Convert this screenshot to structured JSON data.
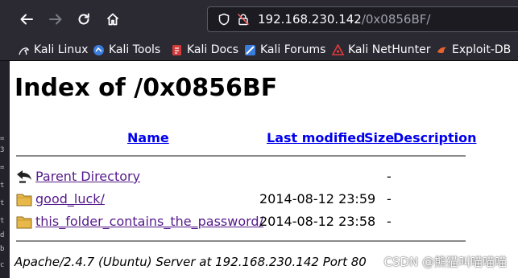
{
  "browser": {
    "url_host": "192.168.230.142",
    "url_path": "/0x0856BF/",
    "bookmarks": [
      {
        "label": "Kali Linux",
        "icon": "kali-dragon-icon"
      },
      {
        "label": "Kali Tools",
        "icon": "kali-tools-icon"
      },
      {
        "label": "Kali Docs",
        "icon": "kali-docs-icon"
      },
      {
        "label": "Kali Forums",
        "icon": "kali-forums-icon"
      },
      {
        "label": "Kali NetHunter",
        "icon": "nethunter-icon"
      },
      {
        "label": "Exploit-DB",
        "icon": "exploit-db-icon"
      }
    ]
  },
  "page": {
    "title": "Index of /0x0856BF",
    "columns": {
      "name": "Name",
      "modified": "Last modified",
      "size": "Size",
      "description": "Description"
    },
    "rows": [
      {
        "name": "Parent Directory",
        "modified": "",
        "size": "-",
        "icon": "back-arrow-icon"
      },
      {
        "name": "good_luck/",
        "modified": "2014-08-12 23:59",
        "size": "-",
        "icon": "folder-icon"
      },
      {
        "name": "this_folder_contains_the_password/",
        "modified": "2014-08-12 23:58",
        "size": "-",
        "icon": "folder-icon"
      }
    ],
    "address": "Apache/2.4.7 (Ubuntu) Server at 192.168.230.142 Port 80"
  },
  "terminal_chars": [
    "=",
    "3",
    "=",
    "t",
    "t",
    "t",
    "d",
    "b",
    "c"
  ],
  "watermark": "CSDN @熊猫叫喵喵喵",
  "colors": {
    "link": "#0000ee",
    "visited": "#551a8b",
    "chrome": "#2b2a33"
  }
}
